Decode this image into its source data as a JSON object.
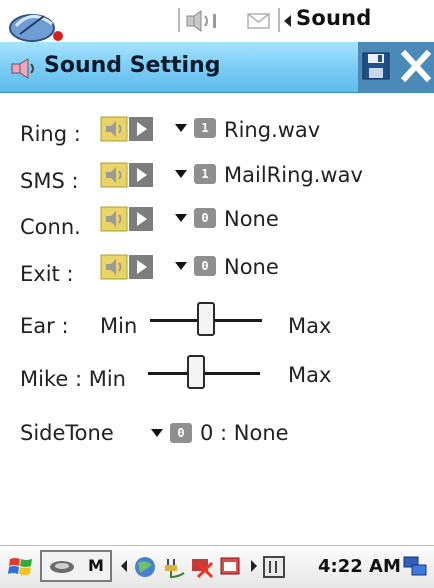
{
  "status_bar": {
    "app_label": "Sound"
  },
  "title_bar": {
    "title": "Sound Setting"
  },
  "settings": {
    "ring": {
      "label": "Ring :",
      "badge": "1",
      "value": "Ring.wav"
    },
    "sms": {
      "label": "SMS :",
      "badge": "1",
      "value": "MailRing.wav"
    },
    "conn": {
      "label": "Conn.",
      "badge": "0",
      "value": "None"
    },
    "exit": {
      "label": "Exit :",
      "badge": "0",
      "value": "None"
    },
    "ear": {
      "label": "Ear :",
      "min_label": "Min",
      "max_label": "Max",
      "level": 0.5
    },
    "mike": {
      "label": "Mike : Min",
      "max_label": "Max",
      "level": 0.43
    },
    "sidetone": {
      "label": "SideTone",
      "badge": "0",
      "value": "0 : None"
    }
  },
  "taskbar": {
    "clock": "4:22 AM",
    "quick_label": "M"
  },
  "colors": {
    "title_gradient_top": "#a7e3ff",
    "title_gradient_bottom": "#5ebbeb",
    "title_right_block": "#4b8ab8",
    "badge_gray": "#8f8f8f"
  },
  "icons": {
    "start": "windows-flag-icon",
    "speaker": "speaker-icon",
    "play": "play-icon",
    "dropdown": "dropdown-arrow-icon",
    "save": "floppy-disk-icon",
    "close": "close-icon"
  }
}
